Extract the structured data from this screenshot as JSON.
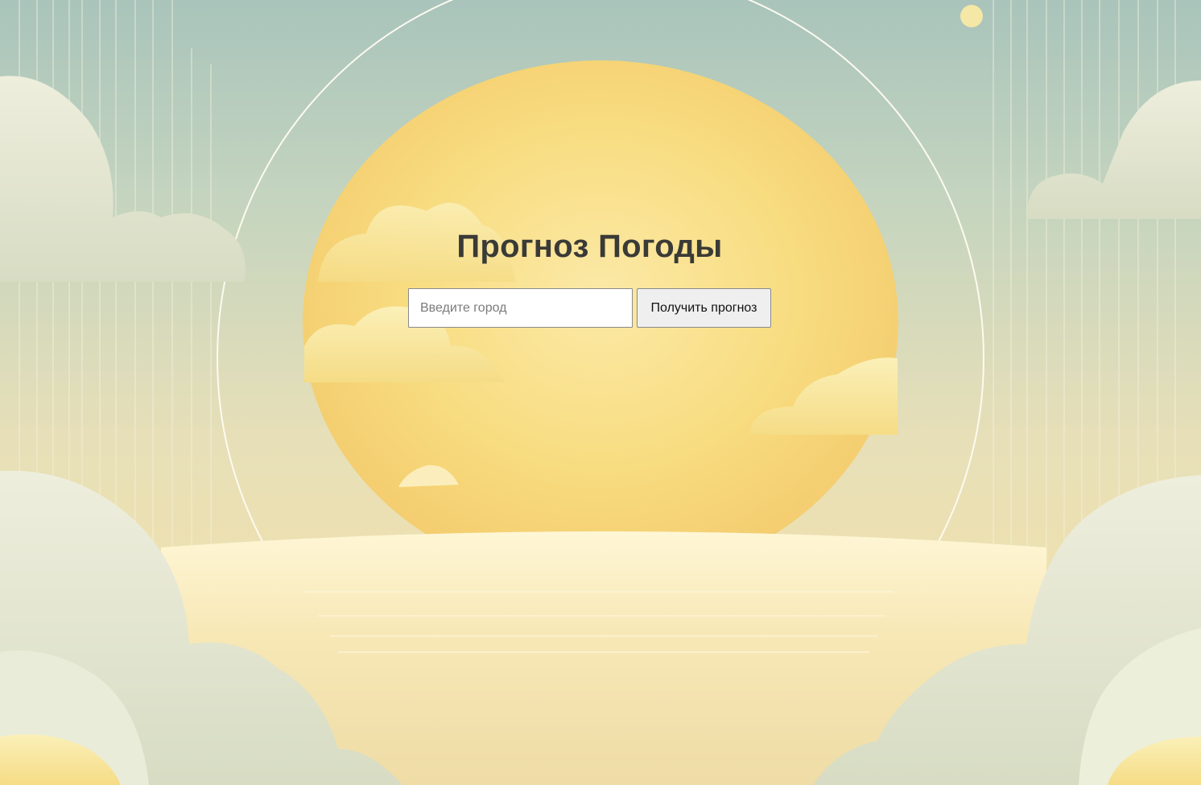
{
  "page": {
    "title": "Прогноз Погоды"
  },
  "search": {
    "placeholder": "Введите город",
    "value": "",
    "button_label": "Получить прогноз"
  },
  "theme": {
    "sky_top": "#a9c4bb",
    "sun_glow": "#f7d77a",
    "cloud": "#f6f3dc",
    "title_color": "#3a3a36"
  }
}
